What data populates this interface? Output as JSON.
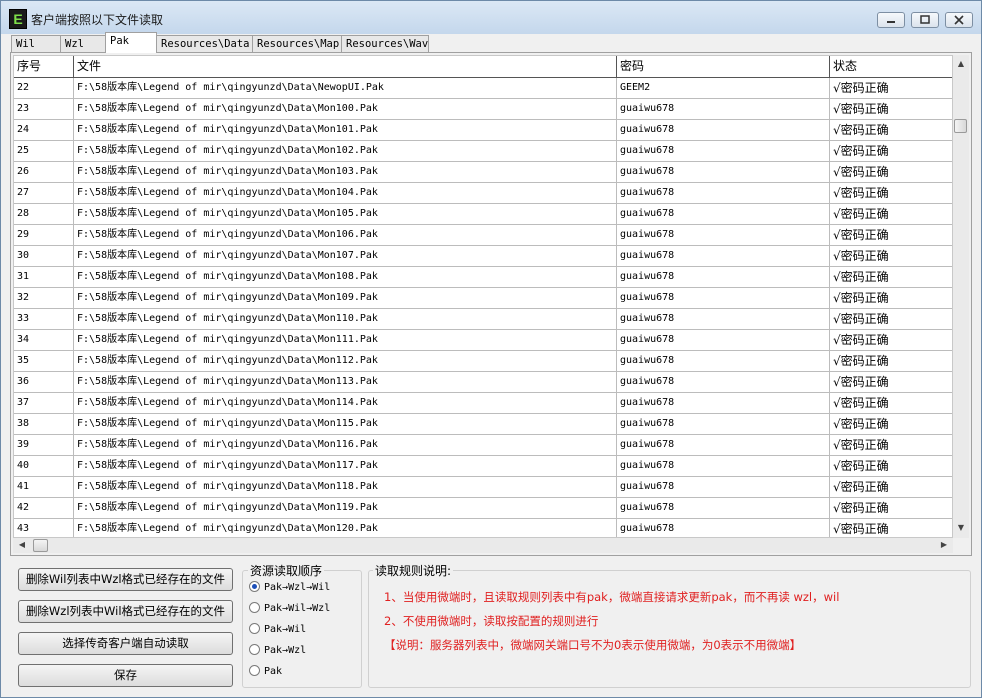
{
  "window": {
    "title": "客户端按照以下文件读取",
    "icon_letter": "E"
  },
  "tabs": [
    "Wil",
    "Wzl",
    "Pak",
    "Resources\\Data",
    "Resources\\Map",
    "Resources\\Wav"
  ],
  "active_tab": "Pak",
  "table": {
    "headers": [
      "序号",
      "文件",
      "密码",
      "状态"
    ],
    "rows": [
      [
        "22",
        "F:\\58版本库\\Legend of mir\\qingyunzd\\Data\\NewopUI.Pak",
        "GEEM2",
        "√密码正确"
      ],
      [
        "23",
        "F:\\58版本库\\Legend of mir\\qingyunzd\\Data\\Mon100.Pak",
        "guaiwu678",
        "√密码正确"
      ],
      [
        "24",
        "F:\\58版本库\\Legend of mir\\qingyunzd\\Data\\Mon101.Pak",
        "guaiwu678",
        "√密码正确"
      ],
      [
        "25",
        "F:\\58版本库\\Legend of mir\\qingyunzd\\Data\\Mon102.Pak",
        "guaiwu678",
        "√密码正确"
      ],
      [
        "26",
        "F:\\58版本库\\Legend of mir\\qingyunzd\\Data\\Mon103.Pak",
        "guaiwu678",
        "√密码正确"
      ],
      [
        "27",
        "F:\\58版本库\\Legend of mir\\qingyunzd\\Data\\Mon104.Pak",
        "guaiwu678",
        "√密码正确"
      ],
      [
        "28",
        "F:\\58版本库\\Legend of mir\\qingyunzd\\Data\\Mon105.Pak",
        "guaiwu678",
        "√密码正确"
      ],
      [
        "29",
        "F:\\58版本库\\Legend of mir\\qingyunzd\\Data\\Mon106.Pak",
        "guaiwu678",
        "√密码正确"
      ],
      [
        "30",
        "F:\\58版本库\\Legend of mir\\qingyunzd\\Data\\Mon107.Pak",
        "guaiwu678",
        "√密码正确"
      ],
      [
        "31",
        "F:\\58版本库\\Legend of mir\\qingyunzd\\Data\\Mon108.Pak",
        "guaiwu678",
        "√密码正确"
      ],
      [
        "32",
        "F:\\58版本库\\Legend of mir\\qingyunzd\\Data\\Mon109.Pak",
        "guaiwu678",
        "√密码正确"
      ],
      [
        "33",
        "F:\\58版本库\\Legend of mir\\qingyunzd\\Data\\Mon110.Pak",
        "guaiwu678",
        "√密码正确"
      ],
      [
        "34",
        "F:\\58版本库\\Legend of mir\\qingyunzd\\Data\\Mon111.Pak",
        "guaiwu678",
        "√密码正确"
      ],
      [
        "35",
        "F:\\58版本库\\Legend of mir\\qingyunzd\\Data\\Mon112.Pak",
        "guaiwu678",
        "√密码正确"
      ],
      [
        "36",
        "F:\\58版本库\\Legend of mir\\qingyunzd\\Data\\Mon113.Pak",
        "guaiwu678",
        "√密码正确"
      ],
      [
        "37",
        "F:\\58版本库\\Legend of mir\\qingyunzd\\Data\\Mon114.Pak",
        "guaiwu678",
        "√密码正确"
      ],
      [
        "38",
        "F:\\58版本库\\Legend of mir\\qingyunzd\\Data\\Mon115.Pak",
        "guaiwu678",
        "√密码正确"
      ],
      [
        "39",
        "F:\\58版本库\\Legend of mir\\qingyunzd\\Data\\Mon116.Pak",
        "guaiwu678",
        "√密码正确"
      ],
      [
        "40",
        "F:\\58版本库\\Legend of mir\\qingyunzd\\Data\\Mon117.Pak",
        "guaiwu678",
        "√密码正确"
      ],
      [
        "41",
        "F:\\58版本库\\Legend of mir\\qingyunzd\\Data\\Mon118.Pak",
        "guaiwu678",
        "√密码正确"
      ],
      [
        "42",
        "F:\\58版本库\\Legend of mir\\qingyunzd\\Data\\Mon119.Pak",
        "guaiwu678",
        "√密码正确"
      ],
      [
        "43",
        "F:\\58版本库\\Legend of mir\\qingyunzd\\Data\\Mon120.Pak",
        "guaiwu678",
        "√密码正确"
      ]
    ]
  },
  "buttons": {
    "delete_wil": "删除Wil列表中Wzl格式已经存在的文件",
    "delete_wzl": "删除Wzl列表中Wil格式已经存在的文件",
    "auto_read": "选择传奇客户端自动读取",
    "save": "保存"
  },
  "order_group": {
    "title": "资源读取顺序",
    "options": [
      "Pak→Wzl→Wil",
      "Pak→Wil→Wzl",
      "Pak→Wil",
      "Pak→Wzl",
      "Pak"
    ],
    "selected": 0
  },
  "rules": {
    "title": "读取规则说明:",
    "lines": [
      "1、当使用微端时，且读取规则列表中有pak，微端直接请求更新pak，而不再读 wzl，wil",
      "2、不使用微端时，读取按配置的规则进行",
      "【说明：服务器列表中，微端网关端口号不为0表示使用微端，为0表示不用微端】"
    ]
  }
}
